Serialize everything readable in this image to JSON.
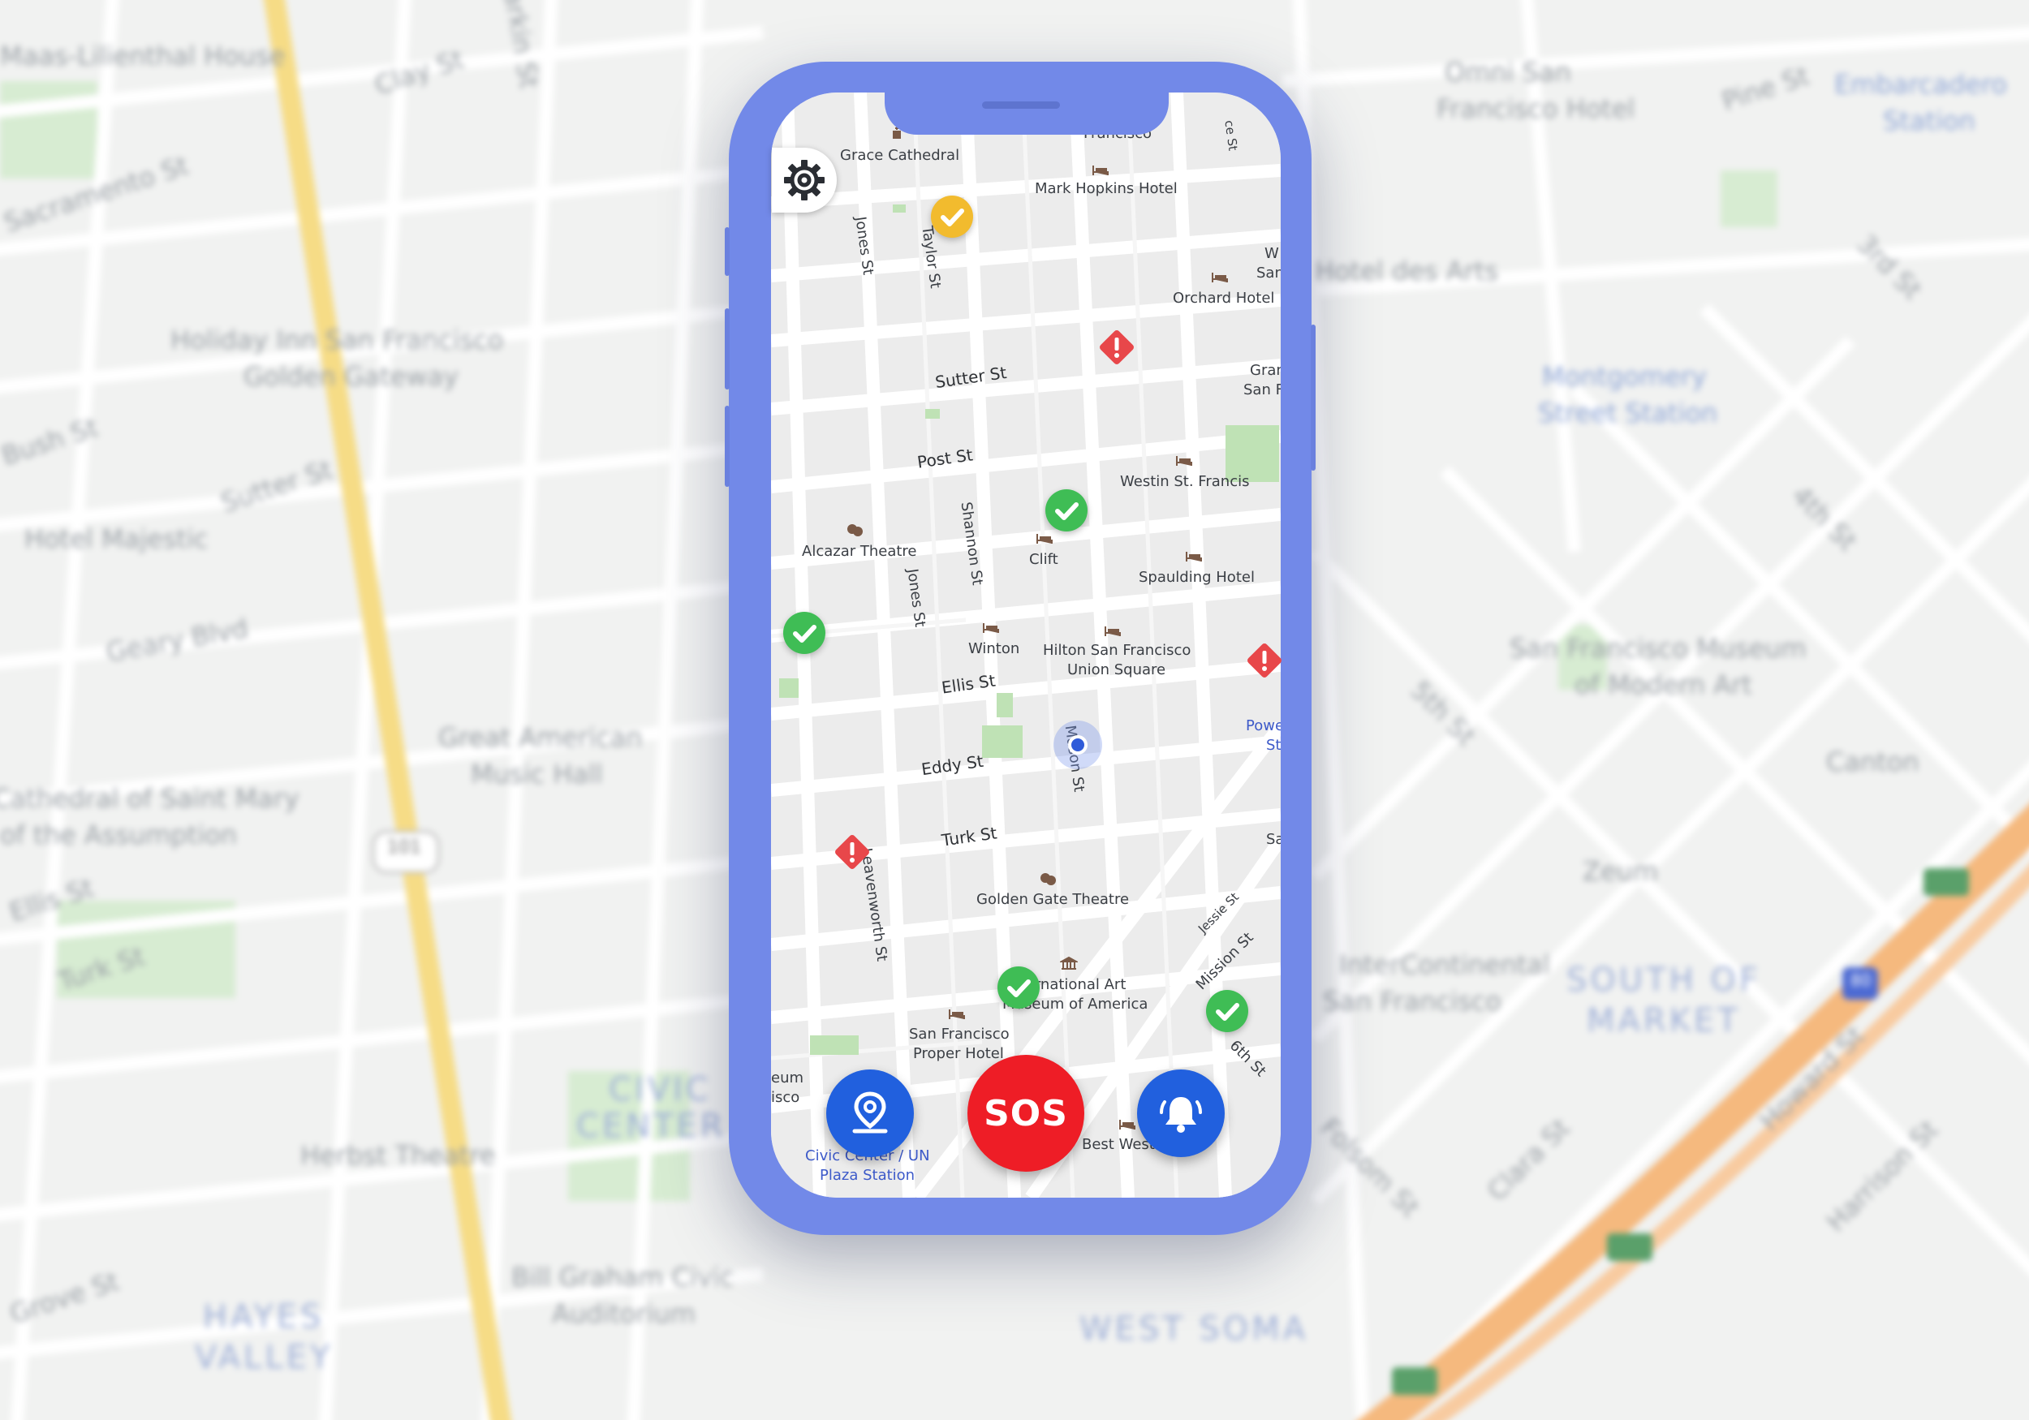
{
  "background_labels": [
    "Maas-Lilienthal House",
    "Clay St",
    "Sacramento St",
    "Larkin St",
    "Holiday Inn San Francisco",
    "Golden Gateway",
    "Bush St",
    "Sutter St",
    "Hotel Majestic",
    "Geary Blvd",
    "Great American",
    "Music Hall",
    "Cathedral of Saint Mary",
    "of the Assumption",
    "Ellis St",
    "Turk St",
    "Herbst Theatre",
    "Bill Graham Civic",
    "Auditorium",
    "Grove St",
    "Omni San",
    "Francisco Hotel",
    "Pine St",
    "Embarcadero",
    "Station",
    "Hotel des Arts",
    "Montgomery",
    "Street Station",
    "San Francisco Museum",
    "of Modern Art",
    "Canton",
    "InterContinental",
    "San Francisco",
    "Zeum",
    "SOUTH OF",
    "MARKET",
    "WEST SOMA",
    "HAYES",
    "VALLEY",
    "CIVIC",
    "CENTER",
    "Harrison St",
    "Howard St",
    "Clara St",
    "Folsom St",
    "5th St",
    "4th St",
    "3rd St",
    "101",
    "80"
  ],
  "map": {
    "streets": {
      "sutter": "Sutter St",
      "post": "Post St",
      "ellis": "Ellis St",
      "eddy": "Eddy St",
      "turk": "Turk St",
      "jones_top": "Jones St",
      "taylor": "Taylor St",
      "shannon": "Shannon St",
      "jones_mid": "Jones St",
      "mason": "Mason St",
      "leavenworth": "Leavenworth St",
      "jessie": "Jessie St",
      "mission": "Mission St",
      "sixth": "6th St"
    },
    "places": {
      "grace_cathedral": "Grace Cathedral",
      "mark_hopkins": "Mark Hopkins Hotel",
      "orchard": "Orchard Hotel",
      "westin": "Westin St. Francis",
      "alcazar": "Alcazar Theatre",
      "clift": "Clift",
      "spaulding": "Spaulding Hotel",
      "winton": "Winton",
      "hilton_1": "Hilton San Francisco",
      "hilton_2": "Union Square",
      "golden_gate": "Golden Gate Theatre",
      "intl_art_1": "International Art",
      "intl_art_2": "Museum of America",
      "proper_1": "San Francisco",
      "proper_2": "Proper Hotel",
      "best_western": "Best Western",
      "civic_1": "Civic Center / UN",
      "civic_2": "Plaza Station",
      "powell_1": "Powell",
      "powell_2": "St",
      "museum_cut_1": "eum",
      "museum_cut_2": "isco",
      "top_cut": "Francisco",
      "top_right_cut": "ce St",
      "w_cut": "W",
      "san_cut": "San",
      "gran_cut": "Gran",
      "sanf_cut": "San F",
      "sa_cut": "Sa"
    }
  },
  "markers": [
    {
      "kind": "check",
      "color": "#f2bb2e"
    },
    {
      "kind": "alert",
      "color": "#e8474a"
    },
    {
      "kind": "check",
      "color": "#3fbd55"
    },
    {
      "kind": "check",
      "color": "#3fbd55"
    },
    {
      "kind": "alert",
      "color": "#e8474a"
    },
    {
      "kind": "alert",
      "color": "#e8474a"
    },
    {
      "kind": "check",
      "color": "#3fbd55"
    },
    {
      "kind": "check",
      "color": "#3fbd55"
    }
  ],
  "controls": {
    "settings_icon": "gear-icon",
    "location_icon": "map-pin-icon",
    "sos_label": "SOS",
    "alerts_icon": "bell-icon"
  },
  "colors": {
    "phone_frame": "#7289e8",
    "sos": "#ee1d26",
    "action_blue": "#2160de",
    "safe": "#3fbd55",
    "caution": "#f2bb2e",
    "danger": "#e8474a"
  }
}
